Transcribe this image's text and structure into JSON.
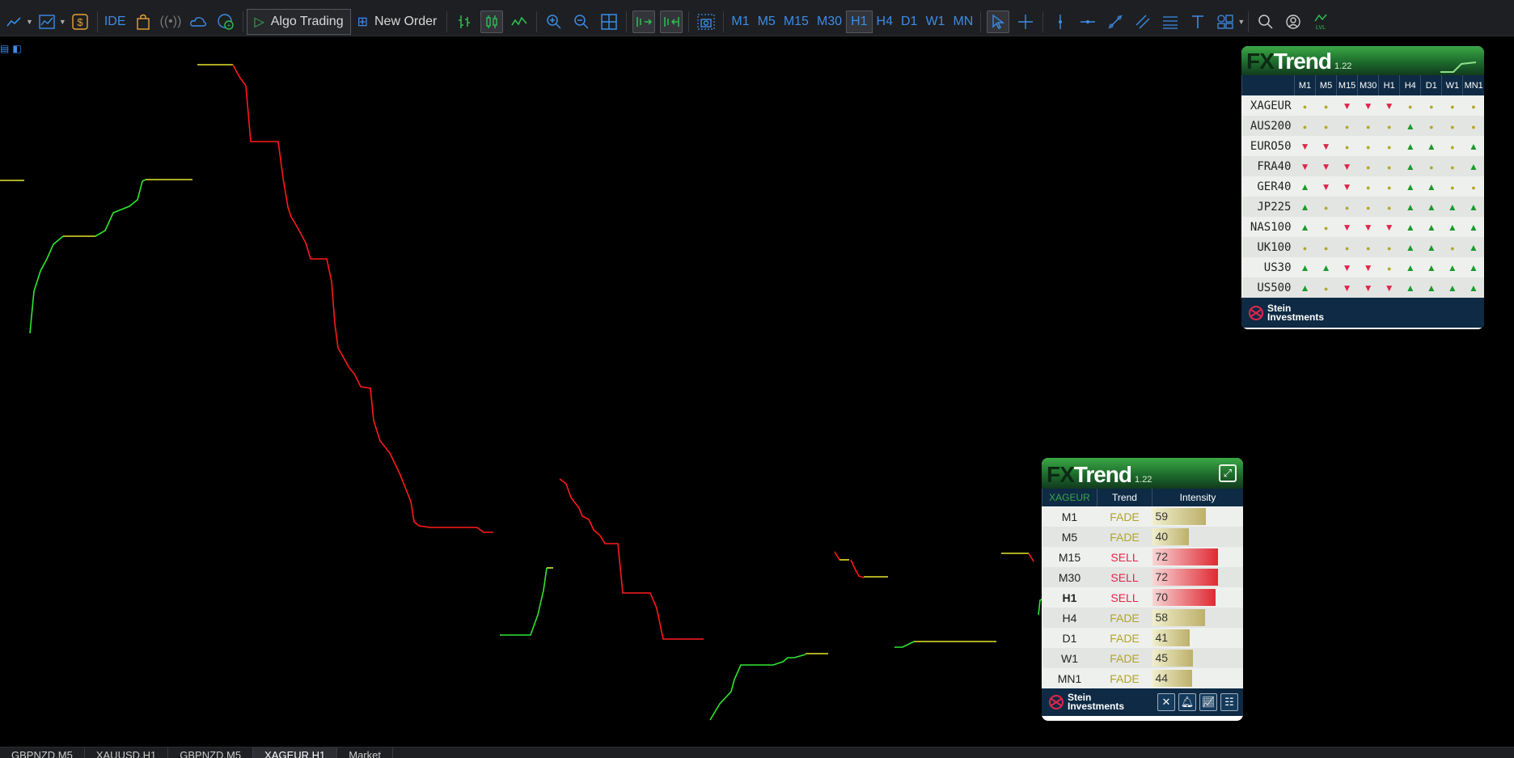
{
  "toolbar": {
    "algo_trading_label": "Algo Trading",
    "new_order_label": "New Order",
    "ide_label": "IDE",
    "timeframes": [
      "M1",
      "M5",
      "M15",
      "M30",
      "H1",
      "H4",
      "D1",
      "W1",
      "MN"
    ],
    "active_timeframe": "H1"
  },
  "tabs": [
    "GBPNZD,M5",
    "XAUUSD,H1",
    "GBPNZD,M5",
    "XAGEUR,H1",
    "Market"
  ],
  "active_tab": "XAGEUR,H1",
  "fx_multi": {
    "logo_fx": "FX",
    "logo_trend": "Trend",
    "version": "1.22",
    "columns": [
      "M1",
      "M5",
      "M15",
      "M30",
      "H1",
      "H4",
      "D1",
      "W1",
      "MN1"
    ],
    "rows": [
      {
        "symbol": "XAGEUR",
        "signals": [
          "dot",
          "dot",
          "down",
          "down",
          "down",
          "dot",
          "dot",
          "dot",
          "dot"
        ]
      },
      {
        "symbol": "AUS200",
        "signals": [
          "dot",
          "dot",
          "dot",
          "dot",
          "dot",
          "up",
          "dot",
          "dot",
          "dot"
        ]
      },
      {
        "symbol": "EURO50",
        "signals": [
          "down",
          "down",
          "dot",
          "dot",
          "dot",
          "up",
          "up",
          "dot",
          "up"
        ]
      },
      {
        "symbol": "FRA40",
        "signals": [
          "down",
          "down",
          "down",
          "dot",
          "dot",
          "up",
          "dot",
          "dot",
          "up"
        ]
      },
      {
        "symbol": "GER40",
        "signals": [
          "up",
          "down",
          "down",
          "dot",
          "dot",
          "up",
          "up",
          "dot",
          "dot"
        ]
      },
      {
        "symbol": "JP225",
        "signals": [
          "up",
          "dot",
          "dot",
          "dot",
          "dot",
          "up",
          "up",
          "up",
          "up"
        ]
      },
      {
        "symbol": "NAS100",
        "signals": [
          "up",
          "dot",
          "down",
          "down",
          "down",
          "up",
          "up",
          "up",
          "up"
        ]
      },
      {
        "symbol": "UK100",
        "signals": [
          "dot",
          "dot",
          "dot",
          "dot",
          "dot",
          "up",
          "up",
          "dot",
          "up"
        ]
      },
      {
        "symbol": "US30",
        "signals": [
          "up",
          "up",
          "down",
          "down",
          "dot",
          "up",
          "up",
          "up",
          "up"
        ]
      },
      {
        "symbol": "US500",
        "signals": [
          "up",
          "dot",
          "down",
          "down",
          "down",
          "up",
          "up",
          "up",
          "up"
        ]
      }
    ],
    "footer_brand_line1": "Stein",
    "footer_brand_line2": "Investments"
  },
  "fx_single": {
    "logo_fx": "FX",
    "logo_trend": "Trend",
    "version": "1.22",
    "header_symbol": "XAGEUR",
    "header_trend": "Trend",
    "header_intensity": "Intensity",
    "rows": [
      {
        "tf": "M1",
        "trend": "FADE",
        "intensity": 59
      },
      {
        "tf": "M5",
        "trend": "FADE",
        "intensity": 40
      },
      {
        "tf": "M15",
        "trend": "SELL",
        "intensity": 72
      },
      {
        "tf": "M30",
        "trend": "SELL",
        "intensity": 72
      },
      {
        "tf": "H1",
        "trend": "SELL",
        "intensity": 70
      },
      {
        "tf": "H4",
        "trend": "FADE",
        "intensity": 58
      },
      {
        "tf": "D1",
        "trend": "FADE",
        "intensity": 41
      },
      {
        "tf": "W1",
        "trend": "FADE",
        "intensity": 45
      },
      {
        "tf": "MN1",
        "trend": "FADE",
        "intensity": 44
      }
    ],
    "current_tf": "H1",
    "footer_brand_line1": "Stein",
    "footer_brand_line2": "Investments"
  },
  "colors": {
    "up": "#1c9a2d",
    "down": "#e0254a",
    "fade": "#b1a32b",
    "line_green": "#2ee82e",
    "line_yellow": "#e6e62a",
    "line_red": "#ff1a1a"
  }
}
